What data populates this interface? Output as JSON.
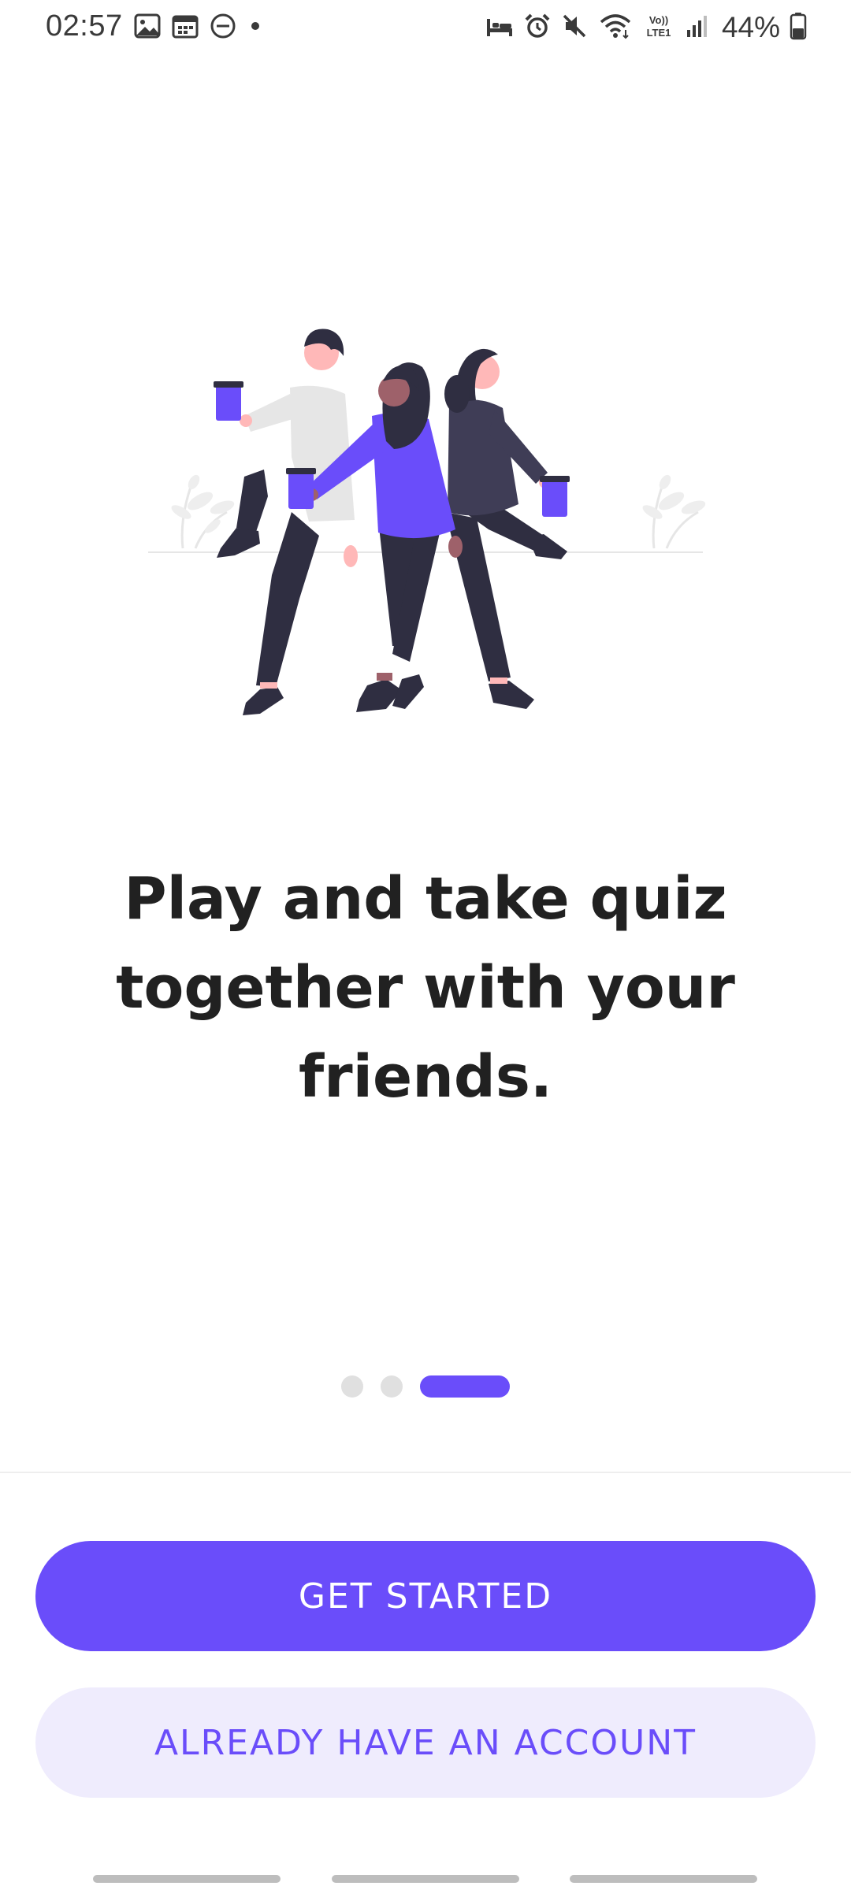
{
  "status_bar": {
    "time": "02:57",
    "left_icons": [
      "gallery-icon",
      "calendar-icon",
      "dnd-icon",
      "dot-icon"
    ],
    "right_icons": [
      "sleep-mode-icon",
      "alarm-icon",
      "mute-icon",
      "wifi-icon",
      "volte-icon",
      "signal-icon"
    ],
    "volte_label": "Vo)) LTE1",
    "battery_percent": "44%",
    "battery_level": 0.44
  },
  "onboarding": {
    "illustration": "friends-with-coffee-cups-illustration",
    "headline_lines": [
      "Play and take quiz",
      "together with your",
      "friends."
    ],
    "pager": {
      "total": 3,
      "active_index": 2
    }
  },
  "actions": {
    "get_started_label": "GET STARTED",
    "have_account_label": "ALREADY HAVE AN ACCOUNT"
  },
  "colors": {
    "accent": "#6a4dfa",
    "accent_light": "#efecfd",
    "text": "#212121",
    "dot_inactive": "#e0e0e0"
  }
}
